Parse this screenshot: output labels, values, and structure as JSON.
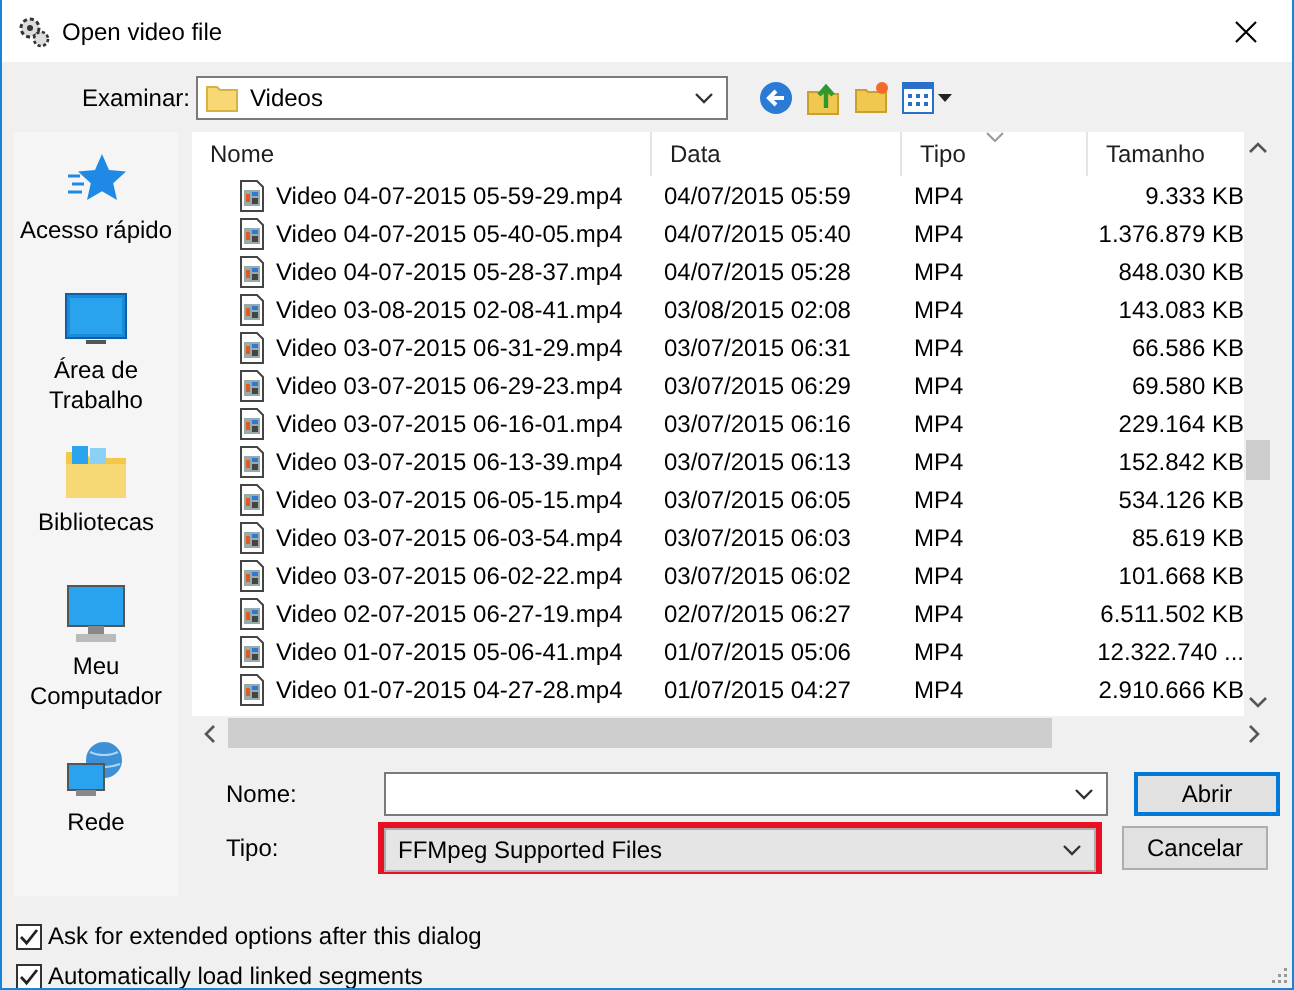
{
  "window": {
    "title": "Open video file"
  },
  "look_in": {
    "label": "Examinar:",
    "value": "Videos"
  },
  "places": [
    {
      "label": "Acesso rápido",
      "kind": "star"
    },
    {
      "label": "Área de Trabalho",
      "kind": "desktop"
    },
    {
      "label": "Bibliotecas",
      "kind": "library"
    },
    {
      "label": "Meu Computador",
      "kind": "computer"
    },
    {
      "label": "Rede",
      "kind": "network"
    }
  ],
  "file_list": {
    "columns": [
      {
        "label": "Nome",
        "sorted": false
      },
      {
        "label": "Data",
        "sorted": false
      },
      {
        "label": "Tipo",
        "sorted": true
      },
      {
        "label": "Tamanho",
        "sorted": false
      }
    ],
    "rows": [
      {
        "name": "Video 04-07-2015 05-59-29.mp4",
        "date": "04/07/2015 05:59",
        "type": "MP4",
        "size": "9.333 KB"
      },
      {
        "name": "Video 04-07-2015 05-40-05.mp4",
        "date": "04/07/2015 05:40",
        "type": "MP4",
        "size": "1.376.879 KB"
      },
      {
        "name": "Video 04-07-2015 05-28-37.mp4",
        "date": "04/07/2015 05:28",
        "type": "MP4",
        "size": "848.030 KB"
      },
      {
        "name": "Video 03-08-2015 02-08-41.mp4",
        "date": "03/08/2015 02:08",
        "type": "MP4",
        "size": "143.083 KB"
      },
      {
        "name": "Video 03-07-2015 06-31-29.mp4",
        "date": "03/07/2015 06:31",
        "type": "MP4",
        "size": "66.586 KB"
      },
      {
        "name": "Video 03-07-2015 06-29-23.mp4",
        "date": "03/07/2015 06:29",
        "type": "MP4",
        "size": "69.580 KB"
      },
      {
        "name": "Video 03-07-2015 06-16-01.mp4",
        "date": "03/07/2015 06:16",
        "type": "MP4",
        "size": "229.164 KB"
      },
      {
        "name": "Video 03-07-2015 06-13-39.mp4",
        "date": "03/07/2015 06:13",
        "type": "MP4",
        "size": "152.842 KB"
      },
      {
        "name": "Video 03-07-2015 06-05-15.mp4",
        "date": "03/07/2015 06:05",
        "type": "MP4",
        "size": "534.126 KB"
      },
      {
        "name": "Video 03-07-2015 06-03-54.mp4",
        "date": "03/07/2015 06:03",
        "type": "MP4",
        "size": "85.619 KB"
      },
      {
        "name": "Video 03-07-2015 06-02-22.mp4",
        "date": "03/07/2015 06:02",
        "type": "MP4",
        "size": "101.668 KB"
      },
      {
        "name": "Video 02-07-2015 06-27-19.mp4",
        "date": "02/07/2015 06:27",
        "type": "MP4",
        "size": "6.511.502 KB"
      },
      {
        "name": "Video 01-07-2015 05-06-41.mp4",
        "date": "01/07/2015 05:06",
        "type": "MP4",
        "size": "12.322.740 ..."
      },
      {
        "name": "Video 01-07-2015 04-27-28.mp4",
        "date": "01/07/2015 04:27",
        "type": "MP4",
        "size": "2.910.666 KB"
      }
    ]
  },
  "name_field": {
    "label": "Nome:"
  },
  "type_field": {
    "label": "Tipo:",
    "value": "FFMpeg Supported Files",
    "highlighted": true
  },
  "buttons": [
    {
      "label": "Abrir",
      "default": true
    },
    {
      "label": "Cancelar",
      "default": false
    }
  ],
  "options": [
    {
      "label": "Ask for extended options after this dialog",
      "checked": true
    },
    {
      "label": "Automatically load linked segments",
      "checked": true
    }
  ]
}
